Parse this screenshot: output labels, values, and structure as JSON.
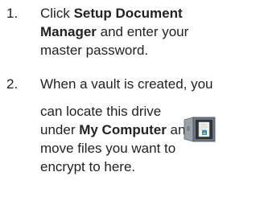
{
  "steps": [
    {
      "number": "1.",
      "lines": [
        {
          "bold": "Setup Document",
          "prefix": "Click "
        },
        {
          "bold": "Manager",
          "suffix": " and enter your"
        },
        {
          "text": "master password."
        }
      ]
    },
    {
      "number": "2.",
      "lines": [
        {
          "text": "When a vault is created, you"
        },
        {
          "text": "can locate this drive"
        },
        {
          "prefix": "under ",
          "bold": "My Computer",
          "suffix": " and"
        },
        {
          "text": "move files you want to"
        },
        {
          "text": "encrypt to here."
        }
      ]
    }
  ],
  "icon": {
    "name": "vault-drive-icon",
    "colors": {
      "door": "#9aa3ab",
      "body": "#6d7780",
      "paper": "#f5f5f0",
      "accent": "#2f8ad8"
    }
  }
}
